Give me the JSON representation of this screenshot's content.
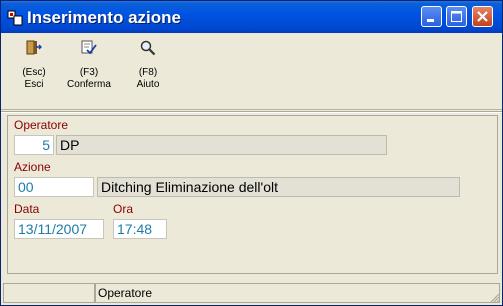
{
  "window": {
    "title": "Inserimento azione"
  },
  "toolbar": {
    "exit": {
      "key": "(Esc)",
      "label": "Esci"
    },
    "confirm": {
      "key": "(F3)",
      "label": "Conferma"
    },
    "help": {
      "key": "(F8)",
      "label": "Aiuto"
    }
  },
  "form": {
    "operator": {
      "label": "Operatore",
      "code": "5",
      "name": "DP"
    },
    "action": {
      "label": "Azione",
      "code": "00",
      "description": "Ditching Eliminazione dell'olt"
    },
    "date": {
      "label": "Data",
      "value": "13/11/2007"
    },
    "time": {
      "label": "Ora",
      "value": "17:48"
    }
  },
  "status": {
    "field_hint": "Operatore"
  }
}
